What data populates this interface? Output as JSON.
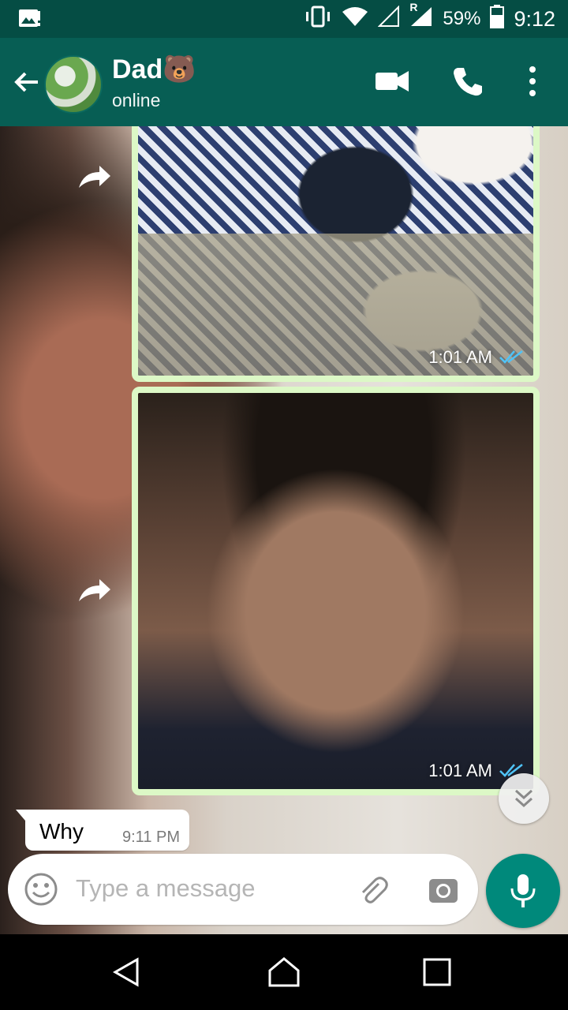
{
  "status_bar": {
    "battery_percent": "59%",
    "time": "9:12",
    "roaming": "R",
    "icons": [
      "image-notification-icon",
      "vibrate-icon",
      "wifi-icon",
      "signal-icon",
      "signal-roaming-icon",
      "battery-icon"
    ]
  },
  "header": {
    "contact_name": "Dad🐻",
    "contact_status": "online",
    "icons": [
      "back-arrow-icon",
      "video-call-icon",
      "phone-call-icon",
      "more-options-icon"
    ]
  },
  "messages": [
    {
      "type": "image",
      "subject": "man and dogs on sofa",
      "time": "1:01 AM",
      "status": "read"
    },
    {
      "type": "image",
      "subject": "man covering face",
      "time": "1:01 AM",
      "status": "read"
    },
    {
      "type": "text",
      "text": "Why",
      "time": "9:11 PM"
    }
  ],
  "composer": {
    "placeholder": "Type a message",
    "icons": [
      "emoji-icon",
      "attach-icon",
      "camera-icon",
      "mic-icon"
    ]
  },
  "colors": {
    "status_bar": "#054d44",
    "app_bar": "#075e54",
    "bubble_out": "#dcf8c6",
    "fab": "#00897b",
    "read_ticks": "#4fc3f7"
  },
  "navigation": [
    "nav-back-icon",
    "nav-home-icon",
    "nav-recents-icon"
  ]
}
